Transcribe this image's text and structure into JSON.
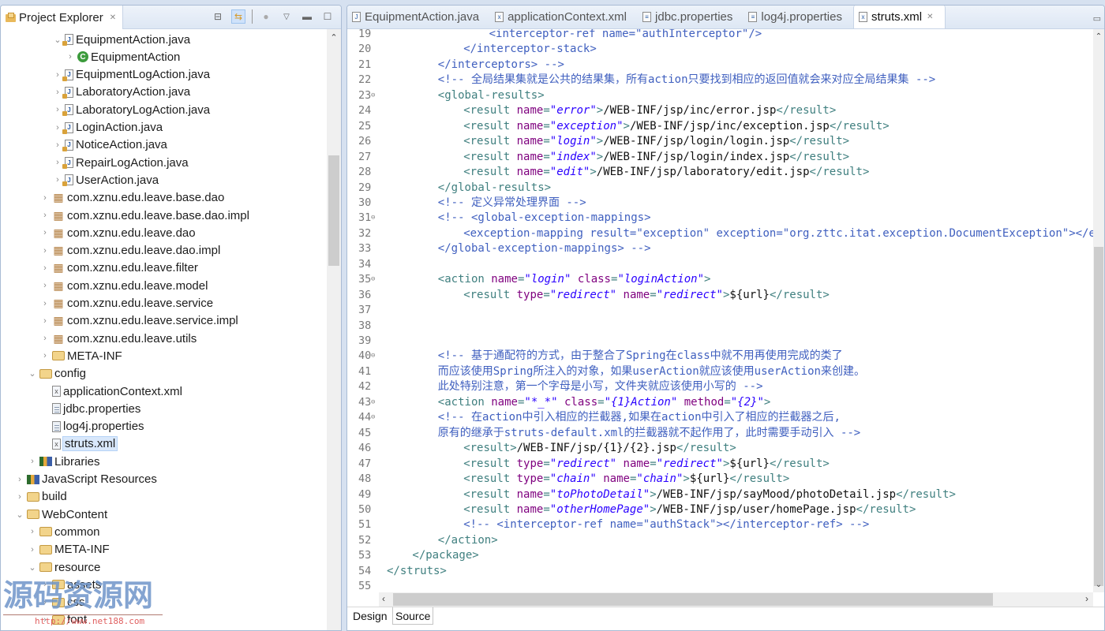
{
  "explorer": {
    "title": "Project Explorer",
    "toolbar": [
      "collapse-all",
      "link-with-editor",
      "filters",
      "view-menu",
      "minimize",
      "maximize"
    ],
    "tree": [
      {
        "label": "EquipmentAction.java",
        "icon": "java-file",
        "depth": 5,
        "expanded": true
      },
      {
        "label": "EquipmentAction",
        "icon": "class",
        "depth": 6,
        "expanded": false
      },
      {
        "label": "EquipmentLogAction.java",
        "icon": "java-file",
        "depth": 5,
        "expanded": false
      },
      {
        "label": "LaboratoryAction.java",
        "icon": "java-file",
        "depth": 5,
        "expanded": false
      },
      {
        "label": "LaboratoryLogAction.java",
        "icon": "java-file",
        "depth": 5,
        "expanded": false
      },
      {
        "label": "LoginAction.java",
        "icon": "java-file",
        "depth": 5,
        "expanded": false
      },
      {
        "label": "NoticeAction.java",
        "icon": "java-file",
        "depth": 5,
        "expanded": false
      },
      {
        "label": "RepairLogAction.java",
        "icon": "java-file",
        "depth": 5,
        "expanded": false
      },
      {
        "label": "UserAction.java",
        "icon": "java-file",
        "depth": 5,
        "expanded": false
      },
      {
        "label": "com.xznu.edu.leave.base.dao",
        "icon": "package",
        "depth": 4,
        "expanded": false
      },
      {
        "label": "com.xznu.edu.leave.base.dao.impl",
        "icon": "package",
        "depth": 4,
        "expanded": false
      },
      {
        "label": "com.xznu.edu.leave.dao",
        "icon": "package",
        "depth": 4,
        "expanded": false
      },
      {
        "label": "com.xznu.edu.leave.dao.impl",
        "icon": "package",
        "depth": 4,
        "expanded": false
      },
      {
        "label": "com.xznu.edu.leave.filter",
        "icon": "package",
        "depth": 4,
        "expanded": false
      },
      {
        "label": "com.xznu.edu.leave.model",
        "icon": "package",
        "depth": 4,
        "expanded": false
      },
      {
        "label": "com.xznu.edu.leave.service",
        "icon": "package",
        "depth": 4,
        "expanded": false
      },
      {
        "label": "com.xznu.edu.leave.service.impl",
        "icon": "package",
        "depth": 4,
        "expanded": false
      },
      {
        "label": "com.xznu.edu.leave.utils",
        "icon": "package",
        "depth": 4,
        "expanded": false
      },
      {
        "label": "META-INF",
        "icon": "folder",
        "depth": 4,
        "expanded": false
      },
      {
        "label": "config",
        "icon": "folder",
        "depth": 3,
        "expanded": true
      },
      {
        "label": "applicationContext.xml",
        "icon": "xml-file",
        "depth": 4,
        "leaf": true
      },
      {
        "label": "jdbc.properties",
        "icon": "properties-file",
        "depth": 4,
        "leaf": true
      },
      {
        "label": "log4j.properties",
        "icon": "properties-file",
        "depth": 4,
        "leaf": true
      },
      {
        "label": "struts.xml",
        "icon": "xml-file",
        "depth": 4,
        "leaf": true,
        "selected": true
      },
      {
        "label": "Libraries",
        "icon": "library",
        "depth": 3,
        "expanded": false
      },
      {
        "label": "JavaScript Resources",
        "icon": "library",
        "depth": 2,
        "expanded": false
      },
      {
        "label": "build",
        "icon": "folder",
        "depth": 2,
        "expanded": false
      },
      {
        "label": "WebContent",
        "icon": "folder",
        "depth": 2,
        "expanded": true
      },
      {
        "label": "common",
        "icon": "folder",
        "depth": 3,
        "expanded": false
      },
      {
        "label": "META-INF",
        "icon": "folder",
        "depth": 3,
        "expanded": false
      },
      {
        "label": "resource",
        "icon": "folder",
        "depth": 3,
        "expanded": true
      },
      {
        "label": "assets",
        "icon": "folder",
        "depth": 4,
        "expanded": false
      },
      {
        "label": "css",
        "icon": "folder",
        "depth": 4,
        "expanded": false
      },
      {
        "label": "font",
        "icon": "folder",
        "depth": 4,
        "expanded": false
      }
    ]
  },
  "editor": {
    "tabs": [
      {
        "label": "EquipmentAction.java",
        "icon": "java-file",
        "active": false
      },
      {
        "label": "applicationContext.xml",
        "icon": "xml-file",
        "active": false
      },
      {
        "label": "jdbc.properties",
        "icon": "properties-file",
        "active": false
      },
      {
        "label": "log4j.properties",
        "icon": "properties-file",
        "active": false
      },
      {
        "label": "struts.xml",
        "icon": "xml-file",
        "active": true
      }
    ],
    "lines": [
      {
        "n": 19,
        "indent": 16,
        "tokens": [
          [
            "tag",
            "<interceptor-ref "
          ],
          [
            "attr",
            "name"
          ],
          [
            "tag",
            "=\"authInterceptor\"/>"
          ]
        ],
        "comment": true
      },
      {
        "n": 20,
        "indent": 12,
        "tokens": [
          [
            "cmt",
            "</interceptor-stack>"
          ]
        ]
      },
      {
        "n": 21,
        "indent": 8,
        "tokens": [
          [
            "cmt",
            "</interceptors> -->"
          ]
        ]
      },
      {
        "n": 22,
        "indent": 8,
        "tokens": [
          [
            "cmt",
            "<!-- 全局结果集就是公共的结果集，所有action只要找到相应的返回值就会来对应全局结果集 -->"
          ]
        ]
      },
      {
        "n": 23,
        "indent": 8,
        "fold": true,
        "tokens": [
          [
            "tag",
            "<global-results>"
          ]
        ]
      },
      {
        "n": 24,
        "indent": 12,
        "tokens": [
          [
            "tag",
            "<result "
          ],
          [
            "attr",
            "name"
          ],
          [
            "tag",
            "="
          ],
          [
            "val",
            "\"error\""
          ],
          [
            "tag",
            ">"
          ],
          [
            "text",
            "/WEB-INF/jsp/inc/error.jsp"
          ],
          [
            "tag",
            "</result>"
          ]
        ]
      },
      {
        "n": 25,
        "indent": 12,
        "tokens": [
          [
            "tag",
            "<result "
          ],
          [
            "attr",
            "name"
          ],
          [
            "tag",
            "="
          ],
          [
            "val",
            "\"exception\""
          ],
          [
            "tag",
            ">"
          ],
          [
            "text",
            "/WEB-INF/jsp/inc/exception.jsp"
          ],
          [
            "tag",
            "</result>"
          ]
        ]
      },
      {
        "n": 26,
        "indent": 12,
        "tokens": [
          [
            "tag",
            "<result "
          ],
          [
            "attr",
            "name"
          ],
          [
            "tag",
            "="
          ],
          [
            "val",
            "\"login\""
          ],
          [
            "tag",
            ">"
          ],
          [
            "text",
            "/WEB-INF/jsp/login/login.jsp"
          ],
          [
            "tag",
            "</result>"
          ]
        ]
      },
      {
        "n": 27,
        "indent": 12,
        "tokens": [
          [
            "tag",
            "<result "
          ],
          [
            "attr",
            "name"
          ],
          [
            "tag",
            "="
          ],
          [
            "val",
            "\"index\""
          ],
          [
            "tag",
            ">"
          ],
          [
            "text",
            "/WEB-INF/jsp/login/index.jsp"
          ],
          [
            "tag",
            "</result>"
          ]
        ]
      },
      {
        "n": 28,
        "indent": 12,
        "tokens": [
          [
            "tag",
            "<result "
          ],
          [
            "attr",
            "name"
          ],
          [
            "tag",
            "="
          ],
          [
            "val",
            "\"edit\""
          ],
          [
            "tag",
            ">"
          ],
          [
            "text",
            "/WEB-INF/jsp/laboratory/edit.jsp"
          ],
          [
            "tag",
            "</result>"
          ]
        ]
      },
      {
        "n": 29,
        "indent": 8,
        "tokens": [
          [
            "tag",
            "</global-results>"
          ]
        ]
      },
      {
        "n": 30,
        "indent": 8,
        "tokens": [
          [
            "cmt",
            "<!-- 定义异常处理界面 -->"
          ]
        ]
      },
      {
        "n": 31,
        "indent": 8,
        "fold": true,
        "tokens": [
          [
            "cmt",
            "<!-- <global-exception-mappings>"
          ]
        ]
      },
      {
        "n": 32,
        "indent": 12,
        "tokens": [
          [
            "cmt",
            "<exception-mapping result=\"exception\" exception=\"org.zttc.itat.exception.DocumentException\"></excep"
          ]
        ]
      },
      {
        "n": 33,
        "indent": 8,
        "tokens": [
          [
            "cmt",
            "</global-exception-mappings> -->"
          ]
        ]
      },
      {
        "n": 34,
        "indent": 0,
        "tokens": []
      },
      {
        "n": 35,
        "indent": 8,
        "fold": true,
        "tokens": [
          [
            "tag",
            "<action "
          ],
          [
            "attr",
            "name"
          ],
          [
            "tag",
            "="
          ],
          [
            "val",
            "\"login\""
          ],
          [
            "tag",
            " "
          ],
          [
            "attr",
            "class"
          ],
          [
            "tag",
            "="
          ],
          [
            "val",
            "\"loginAction\""
          ],
          [
            "tag",
            ">"
          ]
        ]
      },
      {
        "n": 36,
        "indent": 12,
        "tokens": [
          [
            "tag",
            "<result "
          ],
          [
            "attr",
            "type"
          ],
          [
            "tag",
            "="
          ],
          [
            "val",
            "\"redirect\""
          ],
          [
            "tag",
            " "
          ],
          [
            "attr",
            "name"
          ],
          [
            "tag",
            "="
          ],
          [
            "val",
            "\"redirect\""
          ],
          [
            "tag",
            ">"
          ],
          [
            "text",
            "${url}"
          ],
          [
            "tag",
            "</result>"
          ]
        ]
      },
      {
        "n": 37,
        "indent": 0,
        "tokens": []
      },
      {
        "n": 38,
        "indent": 0,
        "tokens": []
      },
      {
        "n": 39,
        "indent": 0,
        "tokens": []
      },
      {
        "n": 40,
        "indent": 8,
        "fold": true,
        "tokens": [
          [
            "cmt",
            "<!-- 基于通配符的方式，由于整合了Spring在class中就不用再使用完成的类了"
          ]
        ]
      },
      {
        "n": 41,
        "indent": 8,
        "tokens": [
          [
            "cmt",
            "而应该使用Spring所注入的对象，如果userAction就应该使用userAction来创建。"
          ]
        ]
      },
      {
        "n": 42,
        "indent": 8,
        "tokens": [
          [
            "cmt",
            "此处特别注意，第一个字母是小写，文件夹就应该使用小写的 -->"
          ]
        ]
      },
      {
        "n": 43,
        "indent": 8,
        "fold": true,
        "tokens": [
          [
            "tag",
            "<action "
          ],
          [
            "attr",
            "name"
          ],
          [
            "tag",
            "="
          ],
          [
            "val",
            "\"*_*\""
          ],
          [
            "tag",
            " "
          ],
          [
            "attr",
            "class"
          ],
          [
            "tag",
            "="
          ],
          [
            "val",
            "\"{1}Action\""
          ],
          [
            "tag",
            " "
          ],
          [
            "attr",
            "method"
          ],
          [
            "tag",
            "="
          ],
          [
            "val",
            "\"{2}\""
          ],
          [
            "tag",
            ">"
          ]
        ]
      },
      {
        "n": 44,
        "indent": 8,
        "fold": true,
        "tokens": [
          [
            "cmt",
            "<!-- 在action中引入相应的拦截器,如果在action中引入了相应的拦截器之后,"
          ]
        ]
      },
      {
        "n": 45,
        "indent": 8,
        "tokens": [
          [
            "cmt",
            "原有的继承于struts-default.xml的拦截器就不起作用了，此时需要手动引入 -->"
          ]
        ]
      },
      {
        "n": 46,
        "indent": 12,
        "tokens": [
          [
            "tag",
            "<result>"
          ],
          [
            "text",
            "/WEB-INF/jsp/{1}/{2}.jsp"
          ],
          [
            "tag",
            "</result>"
          ]
        ]
      },
      {
        "n": 47,
        "indent": 12,
        "tokens": [
          [
            "tag",
            "<result "
          ],
          [
            "attr",
            "type"
          ],
          [
            "tag",
            "="
          ],
          [
            "val",
            "\"redirect\""
          ],
          [
            "tag",
            " "
          ],
          [
            "attr",
            "name"
          ],
          [
            "tag",
            "="
          ],
          [
            "val",
            "\"redirect\""
          ],
          [
            "tag",
            ">"
          ],
          [
            "text",
            "${url}"
          ],
          [
            "tag",
            "</result>"
          ]
        ]
      },
      {
        "n": 48,
        "indent": 12,
        "tokens": [
          [
            "tag",
            "<result "
          ],
          [
            "attr",
            "type"
          ],
          [
            "tag",
            "="
          ],
          [
            "val",
            "\"chain\""
          ],
          [
            "tag",
            " "
          ],
          [
            "attr",
            "name"
          ],
          [
            "tag",
            "="
          ],
          [
            "val",
            "\"chain\""
          ],
          [
            "tag",
            ">"
          ],
          [
            "text",
            "${url}"
          ],
          [
            "tag",
            "</result>"
          ]
        ]
      },
      {
        "n": 49,
        "indent": 12,
        "tokens": [
          [
            "tag",
            "<result "
          ],
          [
            "attr",
            "name"
          ],
          [
            "tag",
            "="
          ],
          [
            "val",
            "\"toPhotoDetail\""
          ],
          [
            "tag",
            ">"
          ],
          [
            "text",
            "/WEB-INF/jsp/sayMood/photoDetail.jsp"
          ],
          [
            "tag",
            "</result>"
          ]
        ]
      },
      {
        "n": 50,
        "indent": 12,
        "tokens": [
          [
            "tag",
            "<result "
          ],
          [
            "attr",
            "name"
          ],
          [
            "tag",
            "="
          ],
          [
            "val",
            "\"otherHomePage\""
          ],
          [
            "tag",
            ">"
          ],
          [
            "text",
            "/WEB-INF/jsp/user/homePage.jsp"
          ],
          [
            "tag",
            "</result>"
          ]
        ]
      },
      {
        "n": 51,
        "indent": 12,
        "tokens": [
          [
            "cmt",
            "<!-- <interceptor-ref name=\"authStack\"></interceptor-ref> -->"
          ]
        ]
      },
      {
        "n": 52,
        "indent": 8,
        "tokens": [
          [
            "tag",
            "</action>"
          ]
        ]
      },
      {
        "n": 53,
        "indent": 4,
        "tokens": [
          [
            "tag",
            "</package>"
          ]
        ]
      },
      {
        "n": 54,
        "indent": 0,
        "tokens": [
          [
            "tag",
            "</struts>"
          ]
        ]
      },
      {
        "n": 55,
        "indent": 0,
        "tokens": []
      }
    ],
    "bottom_tabs": [
      {
        "label": "Design",
        "active": false
      },
      {
        "label": "Source",
        "active": true
      }
    ]
  },
  "watermark": {
    "text": "源码资源网",
    "url": "http://www.net188.com"
  }
}
